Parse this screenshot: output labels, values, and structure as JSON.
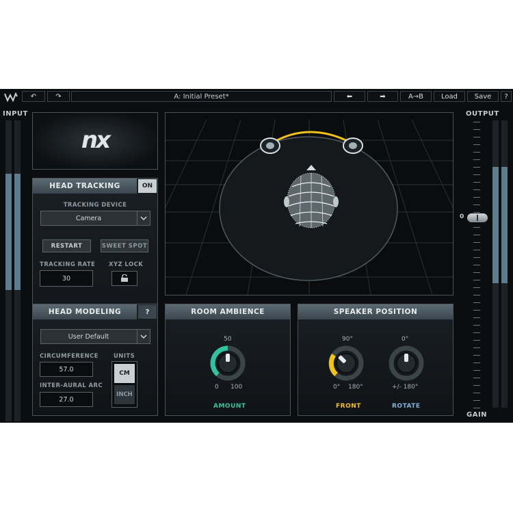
{
  "topbar": {
    "logo_icon": "waves-logo-icon",
    "undo_icon": "undo-icon",
    "redo_icon": "redo-icon",
    "preset_name": "A: Initial Preset*",
    "prev_icon": "arrow-left-icon",
    "next_icon": "arrow-right-icon",
    "ab_label": "A→B",
    "load_label": "Load",
    "save_label": "Save",
    "help_label": "?"
  },
  "input": {
    "label": "INPUT",
    "levels": [
      0.39,
      0.39
    ]
  },
  "output": {
    "label": "OUTPUT",
    "gain_label": "GAIN",
    "gain_value": "0",
    "levels": [
      0.39,
      0.39
    ]
  },
  "logo": {
    "text": "nx"
  },
  "head_tracking": {
    "title": "HEAD TRACKING",
    "toggle": "ON",
    "device_label": "TRACKING DEVICE",
    "device_value": "Camera",
    "restart_label": "RESTART",
    "sweet_spot_label": "SWEET SPOT",
    "rate_label": "TRACKING RATE",
    "rate_value": "30",
    "xyz_label": "XYZ LOCK",
    "lock_icon": "lock-icon"
  },
  "head_modeling": {
    "title": "HEAD MODELING",
    "help": "?",
    "model_value": "User Default",
    "circumference_label": "CIRCUMFERENCE",
    "circumference_value": "57.0",
    "arc_label": "INTER-AURAL ARC",
    "arc_value": "27.0",
    "units_label": "UNITS",
    "unit_cm": "CM",
    "unit_inch": "INCH"
  },
  "room_ambience": {
    "title": "ROOM AMBIENCE",
    "top": "50",
    "min": "0",
    "max": "100",
    "caption": "AMOUNT",
    "value": 50,
    "color": "#2fc4a0"
  },
  "speaker_position": {
    "title": "SPEAKER POSITION",
    "front": {
      "top": "90°",
      "min": "0°",
      "max": "180°",
      "caption": "FRONT",
      "value": 90,
      "color": "#f2c21a"
    },
    "rotate": {
      "top": "0°",
      "range": "+/- 180°",
      "caption": "ROTATE",
      "value": 0,
      "color": "#7fb2d8"
    }
  },
  "colors": {
    "accent_teal": "#2fc4a0",
    "accent_yellow": "#f2c21a",
    "panel_header": "#4b5961"
  }
}
